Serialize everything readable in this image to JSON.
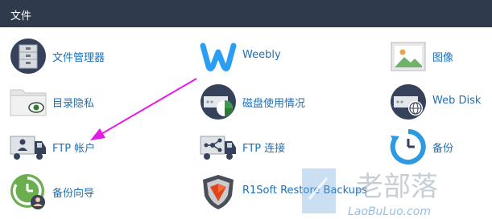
{
  "header": {
    "title": "文件"
  },
  "items": [
    {
      "label": "文件管理器",
      "icon": "file-cabinet-icon"
    },
    {
      "label": "Weebly",
      "icon": "weebly-logo-icon"
    },
    {
      "label": "图像",
      "icon": "image-icon"
    },
    {
      "label": "目录隐私",
      "icon": "folder-eye-icon"
    },
    {
      "label": "磁盘使用情况",
      "icon": "disk-usage-icon"
    },
    {
      "label": "Web Disk",
      "icon": "web-disk-icon"
    },
    {
      "label": "FTP 帐户",
      "icon": "ftp-account-truck-icon"
    },
    {
      "label": "FTP 连接",
      "icon": "ftp-connection-truck-icon"
    },
    {
      "label": "备份",
      "icon": "backup-clock-icon"
    },
    {
      "label": "备份向导",
      "icon": "backup-wizard-icon"
    },
    {
      "label": "R1Soft Restore Backups",
      "icon": "r1soft-shield-icon"
    }
  ],
  "watermark": {
    "text": "老部落",
    "url_text": "LaoBuLuo.com"
  },
  "colors": {
    "header_bg": "#2f3b4c",
    "link": "#1f6fb5",
    "annotation_arrow": "#e619e6"
  }
}
